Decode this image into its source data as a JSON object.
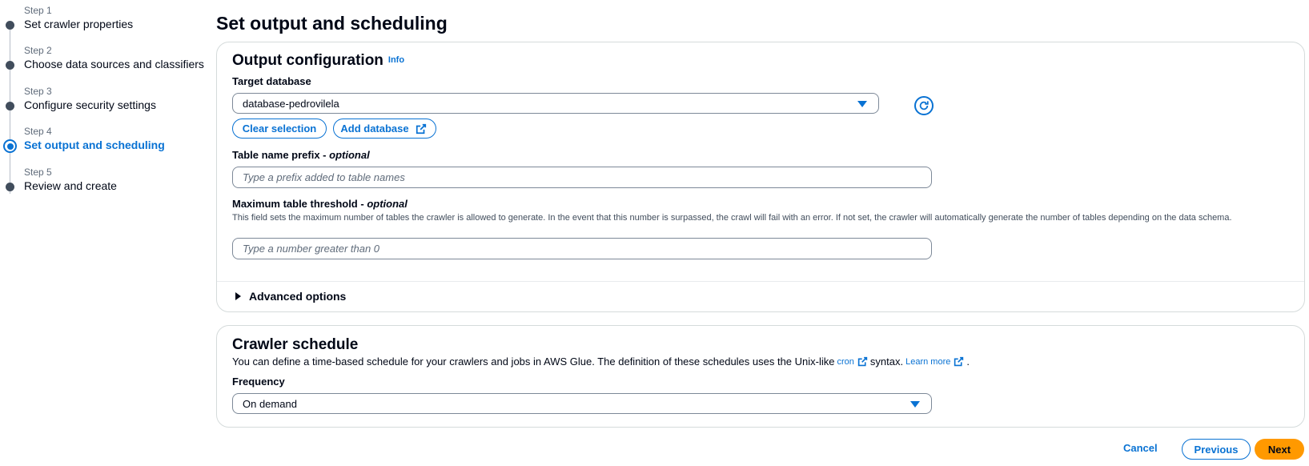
{
  "steps": [
    {
      "num": "Step 1",
      "title": "Set crawler properties",
      "active": false
    },
    {
      "num": "Step 2",
      "title": "Choose data sources and classifiers",
      "active": false
    },
    {
      "num": "Step 3",
      "title": "Configure security settings",
      "active": false
    },
    {
      "num": "Step 4",
      "title": "Set output and scheduling",
      "active": true
    },
    {
      "num": "Step 5",
      "title": "Review and create",
      "active": false
    }
  ],
  "page_title": "Set output and scheduling",
  "output": {
    "heading": "Output configuration",
    "info": "Info",
    "target_db_label": "Target database",
    "target_db_value": "database-pedrovilela",
    "clear_selection": "Clear selection",
    "add_database": "Add database",
    "prefix_label": "Table name prefix - ",
    "prefix_optional": "optional",
    "prefix_placeholder": "Type a prefix added to table names",
    "threshold_label": "Maximum table threshold - ",
    "threshold_optional": "optional",
    "threshold_desc": "This field sets the maximum number of tables the crawler is allowed to generate. In the event that this number is surpassed, the crawl will fail with an error. If not set, the crawler will automatically generate the number of tables depending on the data schema.",
    "threshold_placeholder": "Type a number greater than 0",
    "advanced": "Advanced options"
  },
  "schedule": {
    "heading": "Crawler schedule",
    "desc_prefix": "You can define a time-based schedule for your crawlers and jobs in AWS Glue. The definition of these schedules uses the Unix-like",
    "cron_link": "cron",
    "desc_middle": "syntax.",
    "learn_more": "Learn more",
    "desc_end": ".",
    "frequency_label": "Frequency",
    "frequency_value": "On demand"
  },
  "footer": {
    "cancel": "Cancel",
    "previous": "Previous",
    "next": "Next"
  },
  "colors": {
    "accent": "#0972d3",
    "primary_button": "#ff9900",
    "text": "#000716",
    "border": "#d5dbdb"
  }
}
